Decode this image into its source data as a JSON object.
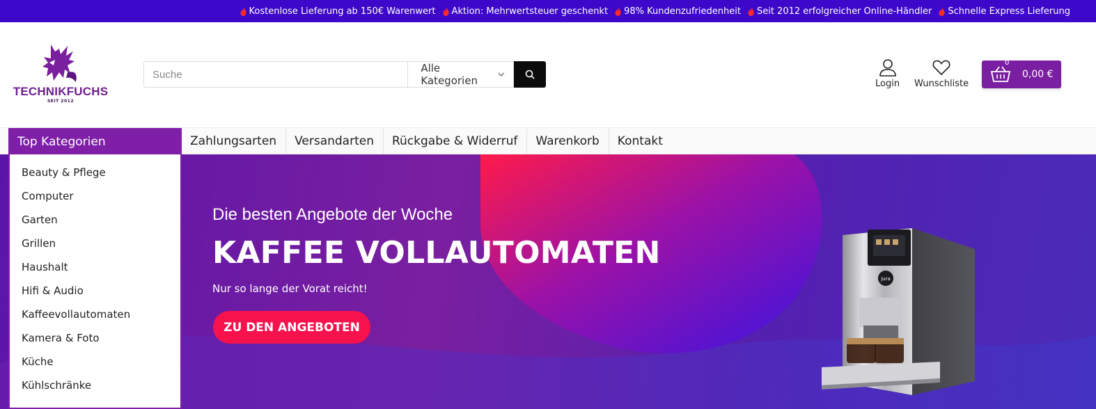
{
  "topbar": {
    "items": [
      "Kostenlose Lieferung ab 150€ Warenwert",
      "Aktion: Mehrwertsteuer geschenkt",
      "98% Kundenzufriedenheit",
      "Seit 2012 erfolgreicher Online-Händler",
      "Schnelle Express Lieferung"
    ]
  },
  "logo": {
    "name": "TECHNIKFUCHS",
    "tagline": "SEIT 2012"
  },
  "search": {
    "placeholder": "Suche",
    "category": "Alle Kategorien"
  },
  "header": {
    "login": "Login",
    "wishlist": "Wunschliste",
    "cart_count": "0",
    "cart_total": "0,00 €"
  },
  "nav": {
    "top_categories": "Top Kategorien",
    "links": [
      "Zahlungsarten",
      "Versandarten",
      "Rückgabe & Widerruf",
      "Warenkorb",
      "Kontakt"
    ]
  },
  "categories": [
    "Beauty & Pflege",
    "Computer",
    "Garten",
    "Grillen",
    "Haushalt",
    "Hifi & Audio",
    "Kaffeevollautomaten",
    "Kamera & Foto",
    "Küche",
    "Kühlschränke"
  ],
  "hero": {
    "subtitle": "Die besten Angebote der Woche",
    "title": "KAFFEE VOLLAUTOMATEN",
    "note": "Nur so lange der Vorat reicht!",
    "button": "ZU DEN ANGEBOTEN",
    "brand": "jura"
  },
  "colors": {
    "topbar": "#3d08c9",
    "brand_purple": "#7f1fa8",
    "cta": "#f7124e",
    "icon_flame": "#ff2a2a"
  }
}
